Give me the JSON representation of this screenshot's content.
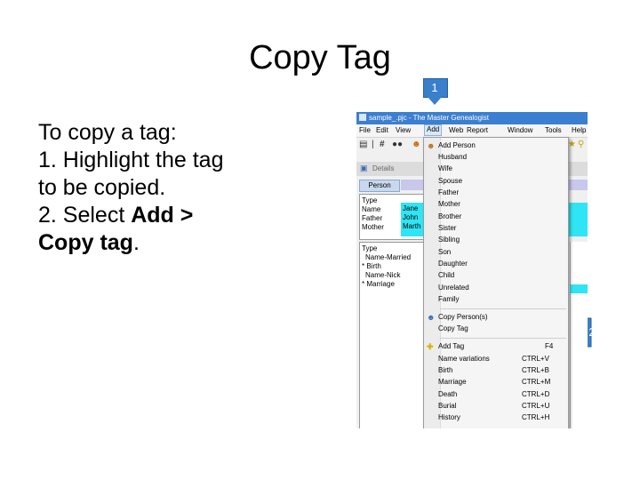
{
  "slide": {
    "title": "Copy Tag",
    "instructions": {
      "line1": "To copy a tag:",
      "line2": "1. Highlight the tag",
      "line3": "to be copied.",
      "line4_prefix": "2. Select ",
      "line4_bold": "Add >",
      "line5_bold": "Copy tag",
      "line5_suffix": "."
    },
    "callouts": [
      "1",
      "2"
    ]
  },
  "app": {
    "window_title": "sample_.pjc - The Master Genealogist",
    "menus": [
      "File",
      "Edit",
      "View",
      "Add",
      "Web",
      "Report",
      "Window",
      "Tools",
      "Help"
    ],
    "active_menu": "Add",
    "details_label": "Details",
    "person_tab": "Person",
    "people_grid": {
      "header": "Type",
      "rows": [
        {
          "type": "Name",
          "value": "Jane"
        },
        {
          "type": "Father",
          "value": "John"
        },
        {
          "type": "Mother",
          "value": "Marth"
        }
      ]
    },
    "tag_grid": {
      "header": "Type",
      "rows": [
        "Name-Married",
        "* Birth",
        "Name-Nick",
        "* Marriage"
      ]
    }
  },
  "add_menu": {
    "group1": [
      "Add Person",
      "Husband",
      "Wife",
      "Spouse",
      "Father",
      "Mother",
      "Brother",
      "Sister",
      "Sibling",
      "Son",
      "Daughter",
      "Child",
      "Unrelated",
      "Family"
    ],
    "group2": [
      "Copy Person(s)",
      "Copy Tag"
    ],
    "group3": [
      {
        "label": "Add Tag",
        "shortcut": "F4"
      },
      {
        "label": "Name variations",
        "shortcut": "CTRL+V"
      },
      {
        "label": "Birth",
        "shortcut": "CTRL+B"
      },
      {
        "label": "Marriage",
        "shortcut": "CTRL+M"
      },
      {
        "label": "Death",
        "shortcut": "CTRL+D"
      },
      {
        "label": "Burial",
        "shortcut": "CTRL+U"
      },
      {
        "label": "History",
        "shortcut": "CTRL+H"
      }
    ]
  },
  "colors": {
    "callout_blue": "#3a7fcc",
    "titlebar_blue": "#3b7fd1",
    "highlight_cyan": "#2fe5f5"
  }
}
